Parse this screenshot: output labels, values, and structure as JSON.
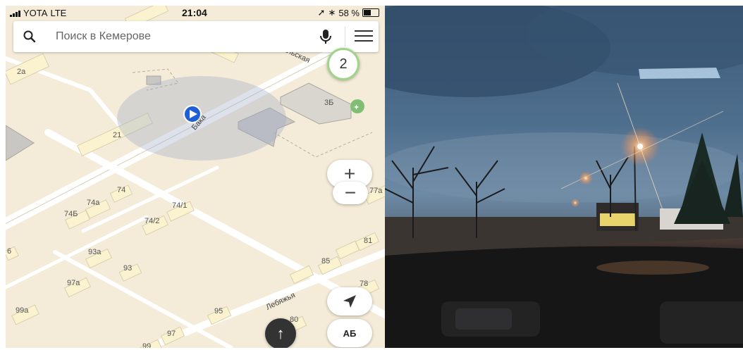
{
  "status_bar": {
    "carrier": "YOTA",
    "network": "LTE",
    "time": "21:04",
    "battery": "58 %",
    "battery_level": 0.58
  },
  "search": {
    "placeholder": "Поиск в Кемерове"
  },
  "map": {
    "buildings": [
      "2а",
      "3Б",
      "21",
      "74",
      "74а",
      "74Б",
      "74/1",
      "74/2",
      "93а",
      "93",
      "97а",
      "99а",
      "95",
      "97",
      "99",
      "85",
      "81",
      "78",
      "80",
      "77а",
      "6"
    ],
    "streets": [
      "Васальская",
      "Бака",
      "Лебяжья"
    ]
  },
  "controls": {
    "traffic_score": "2",
    "zoom_in": "+",
    "zoom_out": "−",
    "route_arrow": "↑",
    "ab_label": "АБ"
  },
  "colors": {
    "map_bg": "#f4ecd8",
    "road": "#ffffff",
    "building": "#fbf3cf",
    "accent": "#1e5ed8",
    "traffic_green": "#9fd48a"
  }
}
